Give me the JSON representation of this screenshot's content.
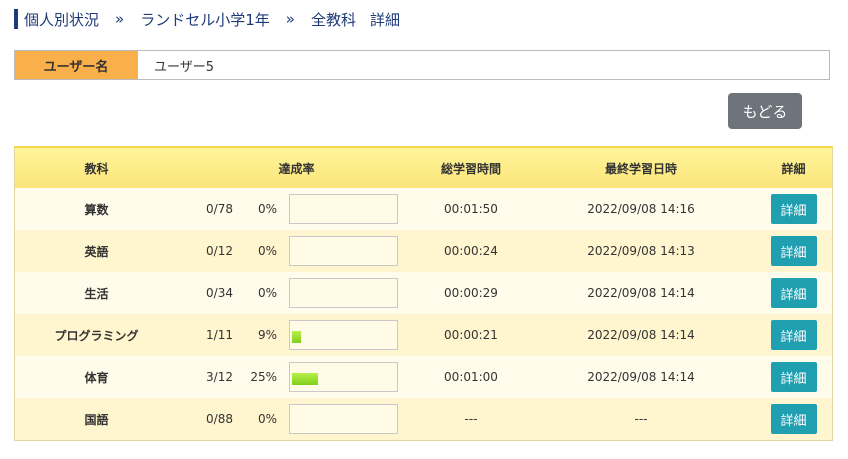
{
  "breadcrumb": {
    "items": [
      "個人別状況",
      "ランドセル小学1年",
      "全教科",
      "詳細"
    ],
    "separator": "»"
  },
  "user": {
    "label": "ユーザー名",
    "value": "ユーザー5"
  },
  "back_label": "もどる",
  "table": {
    "headers": {
      "subject": "教科",
      "rate": "達成率",
      "total_time": "総学習時間",
      "last_date": "最終学習日時",
      "detail": "詳細"
    },
    "rows": [
      {
        "subject": "算数",
        "count": "0/78",
        "pct": "0%",
        "fraction": 0.0,
        "time": "00:01:50",
        "date": "2022/09/08 14:16",
        "detail": "詳細"
      },
      {
        "subject": "英語",
        "count": "0/12",
        "pct": "0%",
        "fraction": 0.0,
        "time": "00:00:24",
        "date": "2022/09/08 14:13",
        "detail": "詳細"
      },
      {
        "subject": "生活",
        "count": "0/34",
        "pct": "0%",
        "fraction": 0.0,
        "time": "00:00:29",
        "date": "2022/09/08 14:14",
        "detail": "詳細"
      },
      {
        "subject": "プログラミング",
        "count": "1/11",
        "pct": "9%",
        "fraction": 0.09,
        "time": "00:00:21",
        "date": "2022/09/08 14:14",
        "detail": "詳細"
      },
      {
        "subject": "体育",
        "count": "3/12",
        "pct": "25%",
        "fraction": 0.25,
        "time": "00:01:00",
        "date": "2022/09/08 14:14",
        "detail": "詳細"
      },
      {
        "subject": "国語",
        "count": "0/88",
        "pct": "0%",
        "fraction": 0.0,
        "time": "---",
        "date": "---",
        "detail": "詳細"
      }
    ]
  },
  "colors": {
    "accent_orange": "#f9b04a",
    "header_yellow": "#fff59a",
    "detail_teal": "#1f9fb0",
    "progress_green": "#7fd01a",
    "back_gray": "#6e747b"
  }
}
